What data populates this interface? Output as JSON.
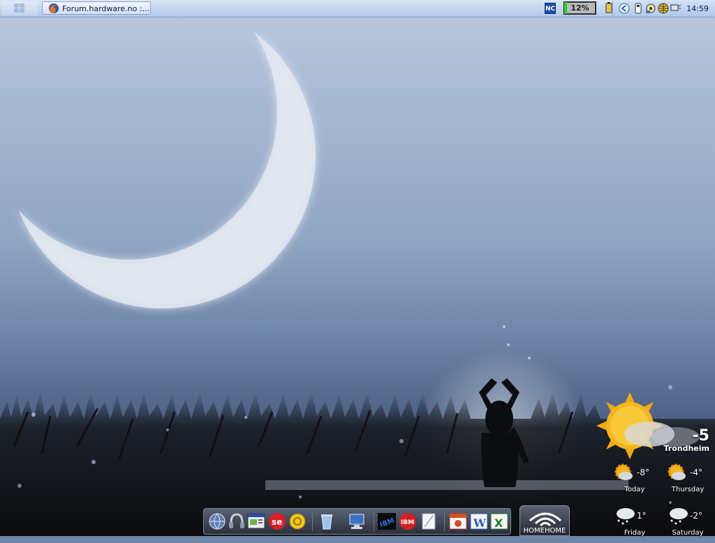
{
  "taskbar": {
    "tasks": [
      {
        "title": "Forum.hardware.no :..."
      }
    ],
    "tray": {
      "nc_label": "NC",
      "cpu_percent_label": "12%",
      "cpu_percent": 12,
      "icons": [
        "battery-icon",
        "usb-device-icon",
        "back-arrow-icon",
        "cd-drive-icon",
        "network-globe-icon",
        "speaker-monitor-icon"
      ],
      "clock": "14:59"
    }
  },
  "dock": {
    "icons": [
      "globe-network-icon",
      "headset-icon",
      "browser-window-icon",
      "se-logo-icon",
      "sun-settings-icon",
      "recycle-bin-icon",
      "my-computer-icon",
      "ibm-icon",
      "ibm-red-icon",
      "notepad-icon",
      "powerpoint-icon",
      "word-icon",
      "excel-icon"
    ],
    "wifi_widget_label": "HOMEHOME"
  },
  "weather": {
    "current_temp": "-5",
    "city": "Trondheim",
    "forecast": [
      {
        "temp": "-8°",
        "day": "Today",
        "icon": "sun-cloud-icon"
      },
      {
        "temp": "-4°",
        "day": "Thursday",
        "icon": "sun-cloud-icon"
      },
      {
        "temp": "1°",
        "day": "Friday",
        "icon": "snow-cloud-icon"
      },
      {
        "temp": "-2°",
        "day": "Saturday",
        "icon": "snow-cloud-icon"
      }
    ]
  },
  "colors": {
    "taskbar": "#c7d7f0",
    "sky_top": "#b8c8de",
    "sky_bottom": "#2d3b58",
    "moon": "#dfe5ef",
    "cpu_fill": "#2fd02f"
  }
}
